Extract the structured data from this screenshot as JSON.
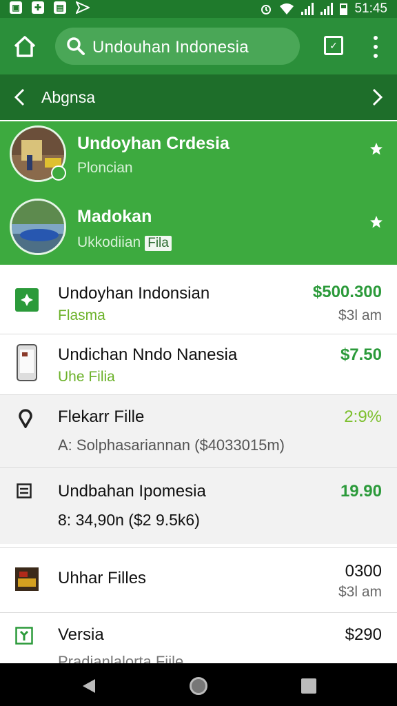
{
  "status_bar": {
    "time": "51:45"
  },
  "app_bar": {
    "search_text": "Undouhan Indonesia"
  },
  "sub_bar": {
    "title": "Abgnsa"
  },
  "featured": [
    {
      "title": "Undoyhan Crdesia",
      "subtitle": "Ploncian",
      "tag": ""
    },
    {
      "title": "Madokan",
      "subtitle": "Ukkodiian",
      "tag": "Fila"
    }
  ],
  "list": [
    {
      "title": "Undoyhan Indonsian",
      "subtitle": "Flasma",
      "value": "$500.300",
      "time": "$3l am",
      "icon": "plus-box-icon"
    },
    {
      "title": "Undichan Nndo Nanesia",
      "subtitle": "Uhe Filia",
      "value": "$7.50",
      "time": "",
      "icon": "phone-icon"
    },
    {
      "title": "Flekarr Fille",
      "subtitle": "A: Solphasariannan ($4033015m)",
      "value": "2:9%",
      "time": "",
      "icon": "location-pin-icon"
    },
    {
      "title": "Undbahan Ipomesia",
      "subtitle": "8: 34,90n ($2 9.5k6)",
      "value": "19.90",
      "time": "",
      "icon": "document-lines-icon"
    },
    {
      "title": "Uhhar Filles",
      "subtitle": "",
      "value": "0300",
      "time": "$3l am",
      "icon": "thumbnail-icon"
    },
    {
      "title": "Versia",
      "subtitle": "Pradianlalorta Fiile",
      "value": "$290",
      "time": "",
      "icon": "tool-box-icon"
    }
  ],
  "colors": {
    "status_bar": "#1f7a2c",
    "app_bar": "#2b8f3a",
    "sub_bar": "#1e6e2a",
    "featured_bg": "#3daa3f",
    "value_green": "#2b9a3a",
    "value_lime": "#7cbf2c"
  }
}
